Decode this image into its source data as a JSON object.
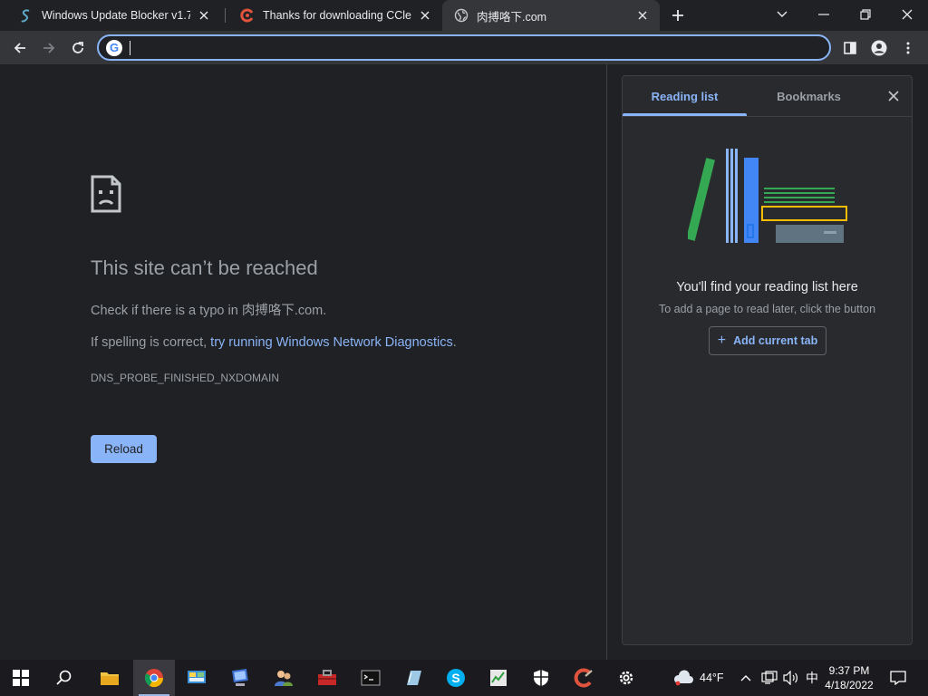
{
  "tabs": [
    {
      "title": "Windows Update Blocker v1.7",
      "icon": "wub-icon"
    },
    {
      "title": "Thanks for downloading CCleaner",
      "icon": "ccleaner-icon"
    },
    {
      "title": "肉搏咯下.com",
      "icon": "globe-icon"
    }
  ],
  "omnibox": {
    "value": "",
    "placeholder": ""
  },
  "error": {
    "title": "This site can’t be reached",
    "typo_prefix": "Check if there is a typo in ",
    "domain": "肉搏咯下.com",
    "typo_suffix": ".",
    "spell_prefix": "If spelling is correct, ",
    "spell_link": "try running Windows Network Diagnostics",
    "spell_suffix": ".",
    "code": "DNS_PROBE_FINISHED_NXDOMAIN",
    "reload_label": "Reload"
  },
  "side_panel": {
    "tab_reading": "Reading list",
    "tab_bookmarks": "Bookmarks",
    "empty_title": "You'll find your reading list here",
    "empty_subtitle": "To add a page to read later, click the button",
    "add_button": "Add current tab"
  },
  "taskbar": {
    "weather_temp": "44°F",
    "ime": "中",
    "time": "9:37 PM",
    "date": "4/18/2022"
  },
  "colors": {
    "accent": "#8ab4f8",
    "page_bg": "#202124",
    "toolbar_bg": "#35363a",
    "panel_bg": "#292a2d",
    "muted_text": "#9aa0a6"
  }
}
